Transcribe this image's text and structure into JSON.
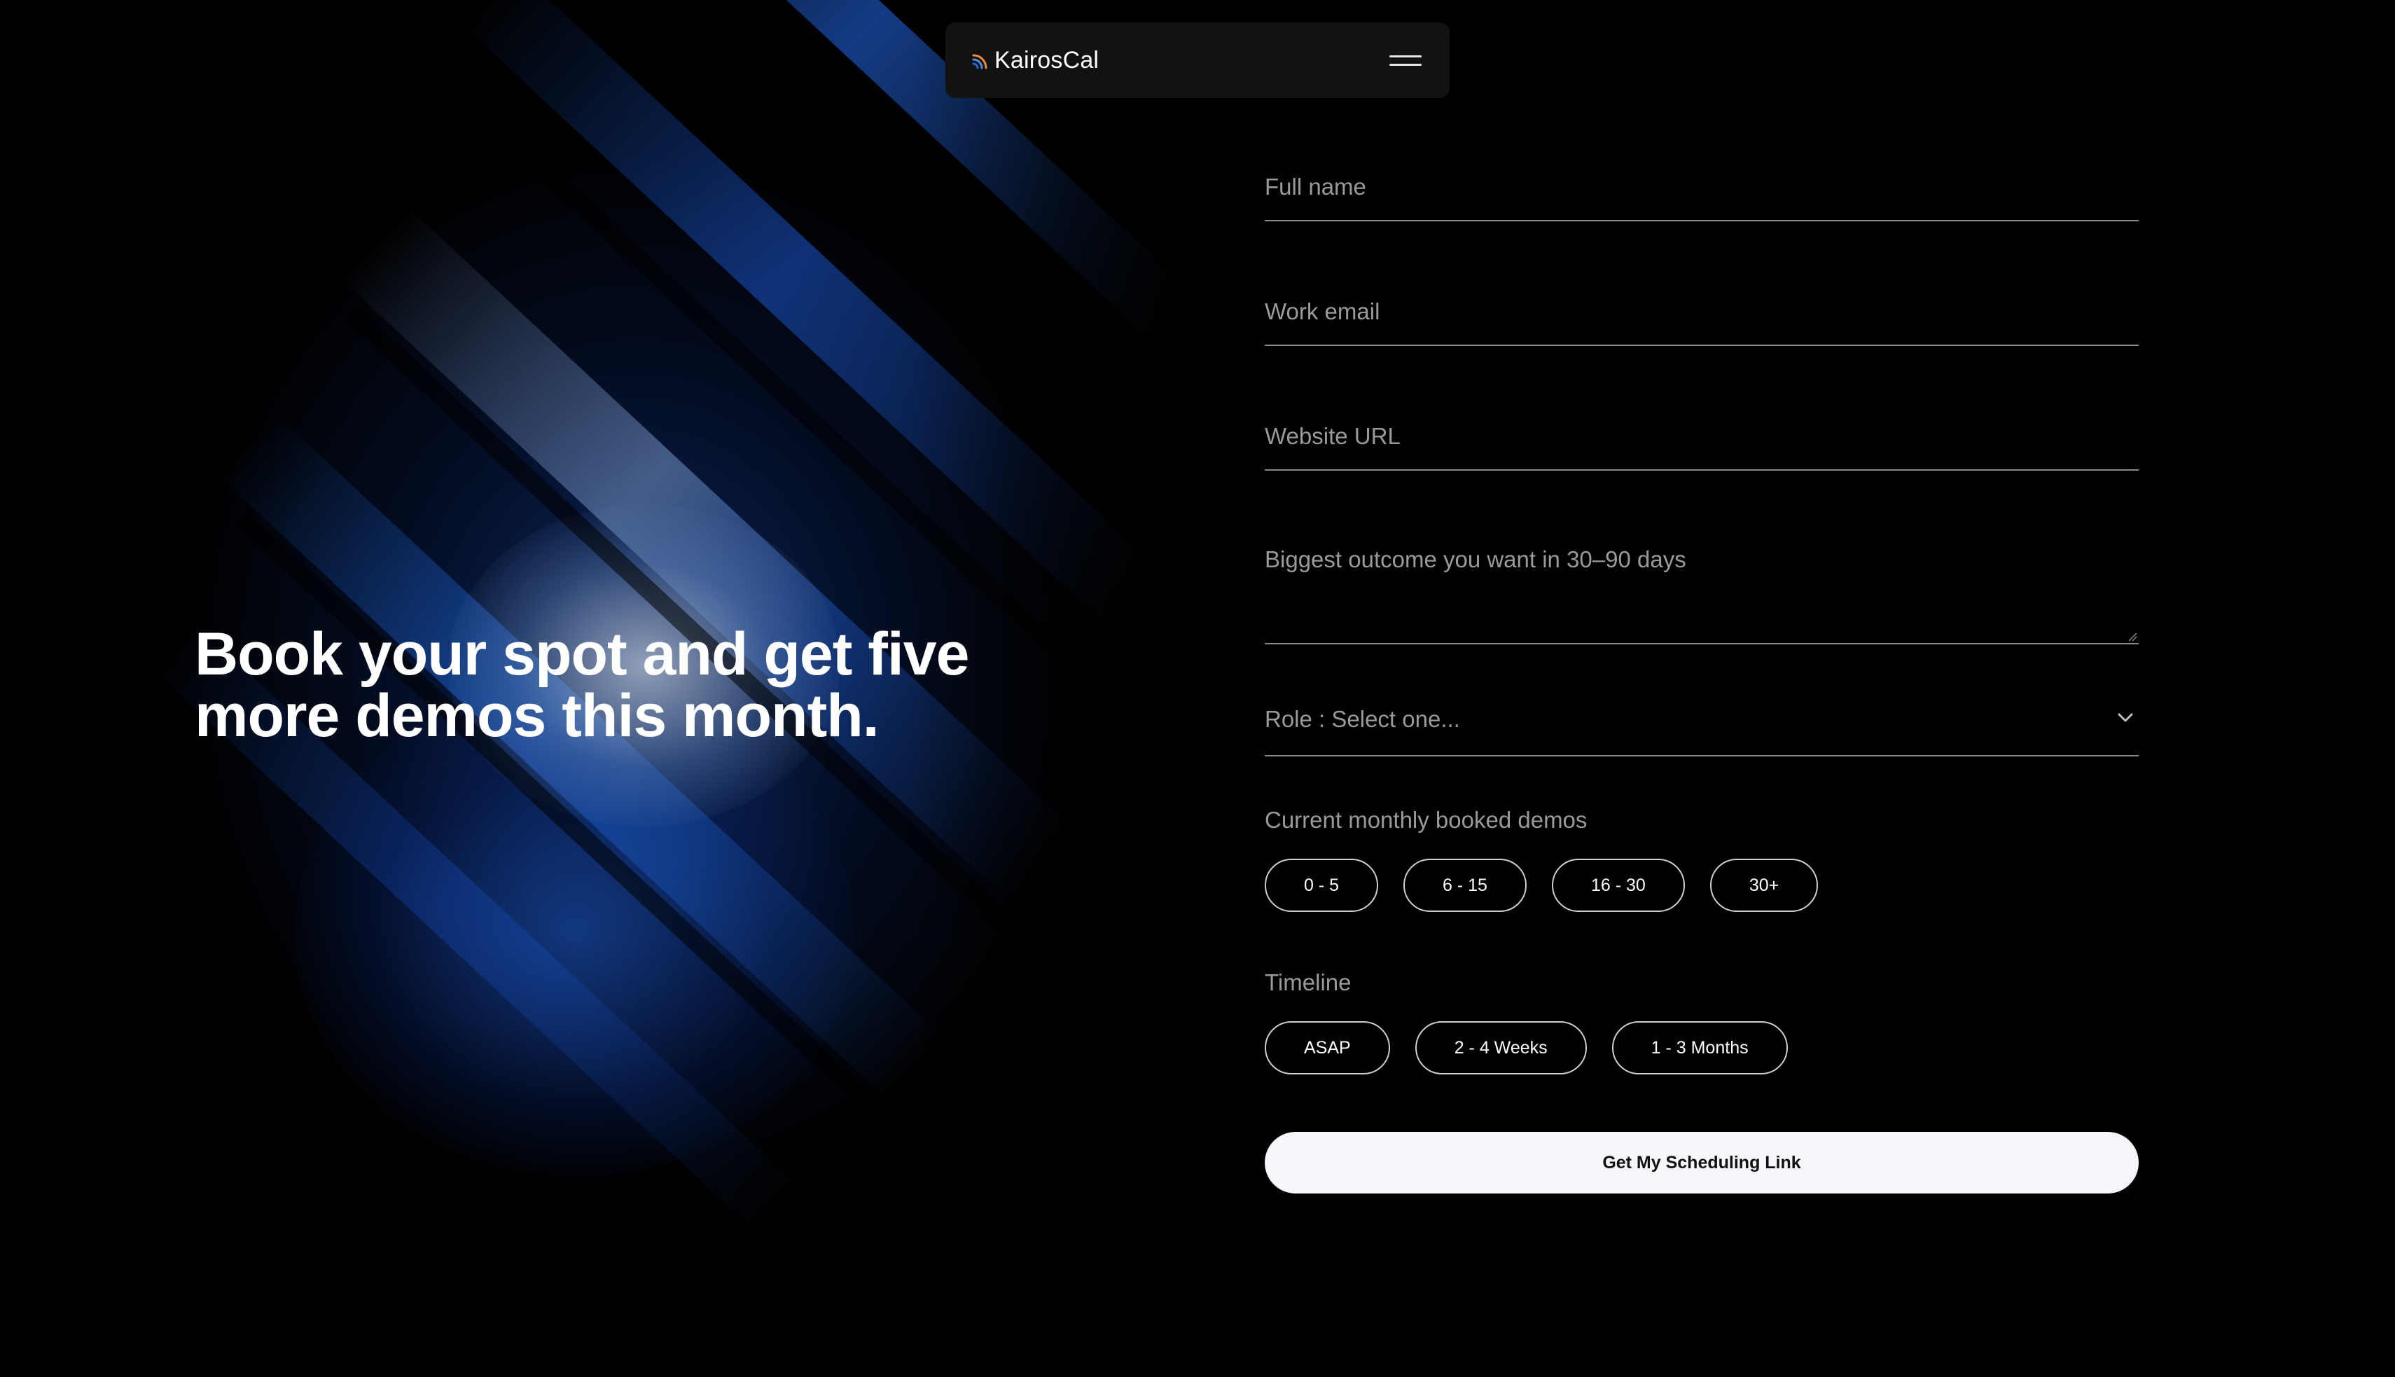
{
  "nav": {
    "brand_name": "KairosCal",
    "logo_icon": "signal-arcs-icon",
    "menu_icon": "hamburger-menu-icon"
  },
  "hero": {
    "headline_line1": "Book your spot and get five",
    "headline_line2": "more demos this month."
  },
  "form": {
    "full_name_placeholder": "Full name",
    "work_email_placeholder": "Work email",
    "website_url_placeholder": "Website URL",
    "outcome_placeholder": "Biggest outcome you want in 30–90 days",
    "role_placeholder": "Role : Select one...",
    "demos_label": "Current monthly booked demos",
    "demos_options": [
      "0 - 5",
      "6 - 15",
      "16 - 30",
      "30+"
    ],
    "timeline_label": "Timeline",
    "timeline_options": [
      "ASAP",
      "2 - 4 Weeks",
      "1 - 3 Months"
    ],
    "submit_label": "Get My Scheduling Link"
  },
  "colors": {
    "background": "#000000",
    "nav_background": "#121212",
    "accent_blue": "#1e5ac8",
    "logo_orange": "#f08a3c",
    "button_background": "#f5f7fa",
    "placeholder_text": "#9a9a9a"
  }
}
